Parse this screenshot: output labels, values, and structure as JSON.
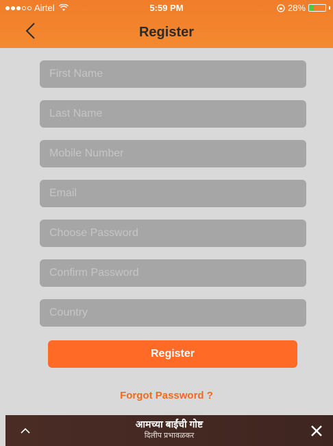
{
  "status_bar": {
    "carrier": "Airtel",
    "time": "5:59 PM",
    "battery": "28%",
    "battery_level": 0.28,
    "signal_dots_filled": 3,
    "signal_dots_total": 5,
    "icons": [
      "wifi-icon",
      "rotation-lock-icon",
      "battery-icon"
    ]
  },
  "header": {
    "title": "Register",
    "back_icon": "chevron-left-icon"
  },
  "form": {
    "fields": [
      {
        "placeholder": "First Name"
      },
      {
        "placeholder": "Last Name"
      },
      {
        "placeholder": "Mobile Number"
      },
      {
        "placeholder": "Email"
      },
      {
        "placeholder": "Choose Password"
      },
      {
        "placeholder": "Confirm Password"
      },
      {
        "placeholder": "Country"
      }
    ],
    "register_label": "Register",
    "forgot_password": "Forgot Password ?"
  },
  "player": {
    "title": "आमच्या बाईंची गोष्ट",
    "subtitle": "दिलीप प्रभावळकर",
    "expand_icon": "chevron-up-icon",
    "close_icon": "close-icon"
  },
  "colors": {
    "accent": "#ff6a26",
    "header": "#f07d2a",
    "field_bg": "#a6a6a6",
    "page_bg": "#d9d9d9",
    "player_bg": "#4a2c25"
  }
}
